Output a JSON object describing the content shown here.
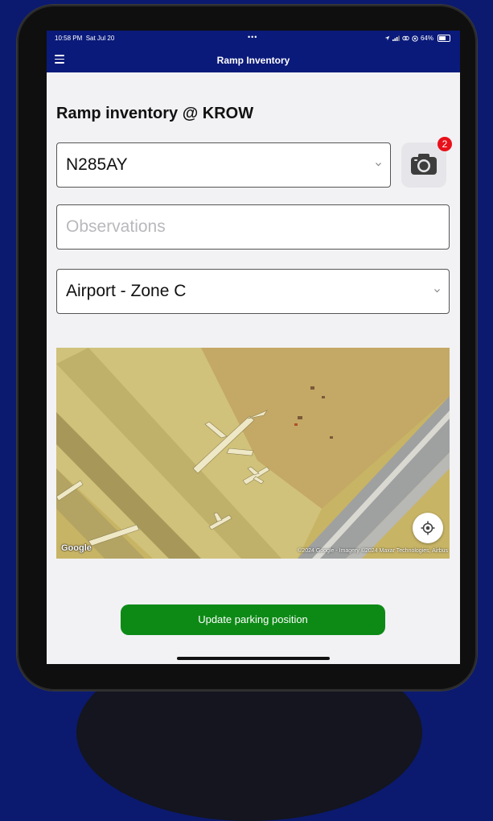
{
  "status_bar": {
    "time": "10:58 PM",
    "date": "Sat Jul 20",
    "dots": "•••",
    "battery_percent": "64%",
    "battery_level": 0.64
  },
  "navbar": {
    "title": "Ramp Inventory",
    "menu_icon": "hamburger-menu-icon"
  },
  "form": {
    "heading": "Ramp inventory @  KROW",
    "aircraft_select": {
      "value": "N285AY"
    },
    "observations": {
      "placeholder": "Observations",
      "value": ""
    },
    "zone_select": {
      "value": "Airport - Zone C"
    },
    "camera": {
      "icon": "camera-icon",
      "badge_count": "2"
    }
  },
  "map": {
    "logo_text": "Google",
    "attribution": "©2024 Google - Imagery ©2024 Maxar Technologies, Airbus",
    "locate_icon": "my-location-icon"
  },
  "actions": {
    "update_button": "Update parking position"
  },
  "colors": {
    "brand": "#0a1a7a",
    "primary_action": "#0d8a16",
    "badge": "#e8101a",
    "page_background": "#0b1a6e"
  }
}
